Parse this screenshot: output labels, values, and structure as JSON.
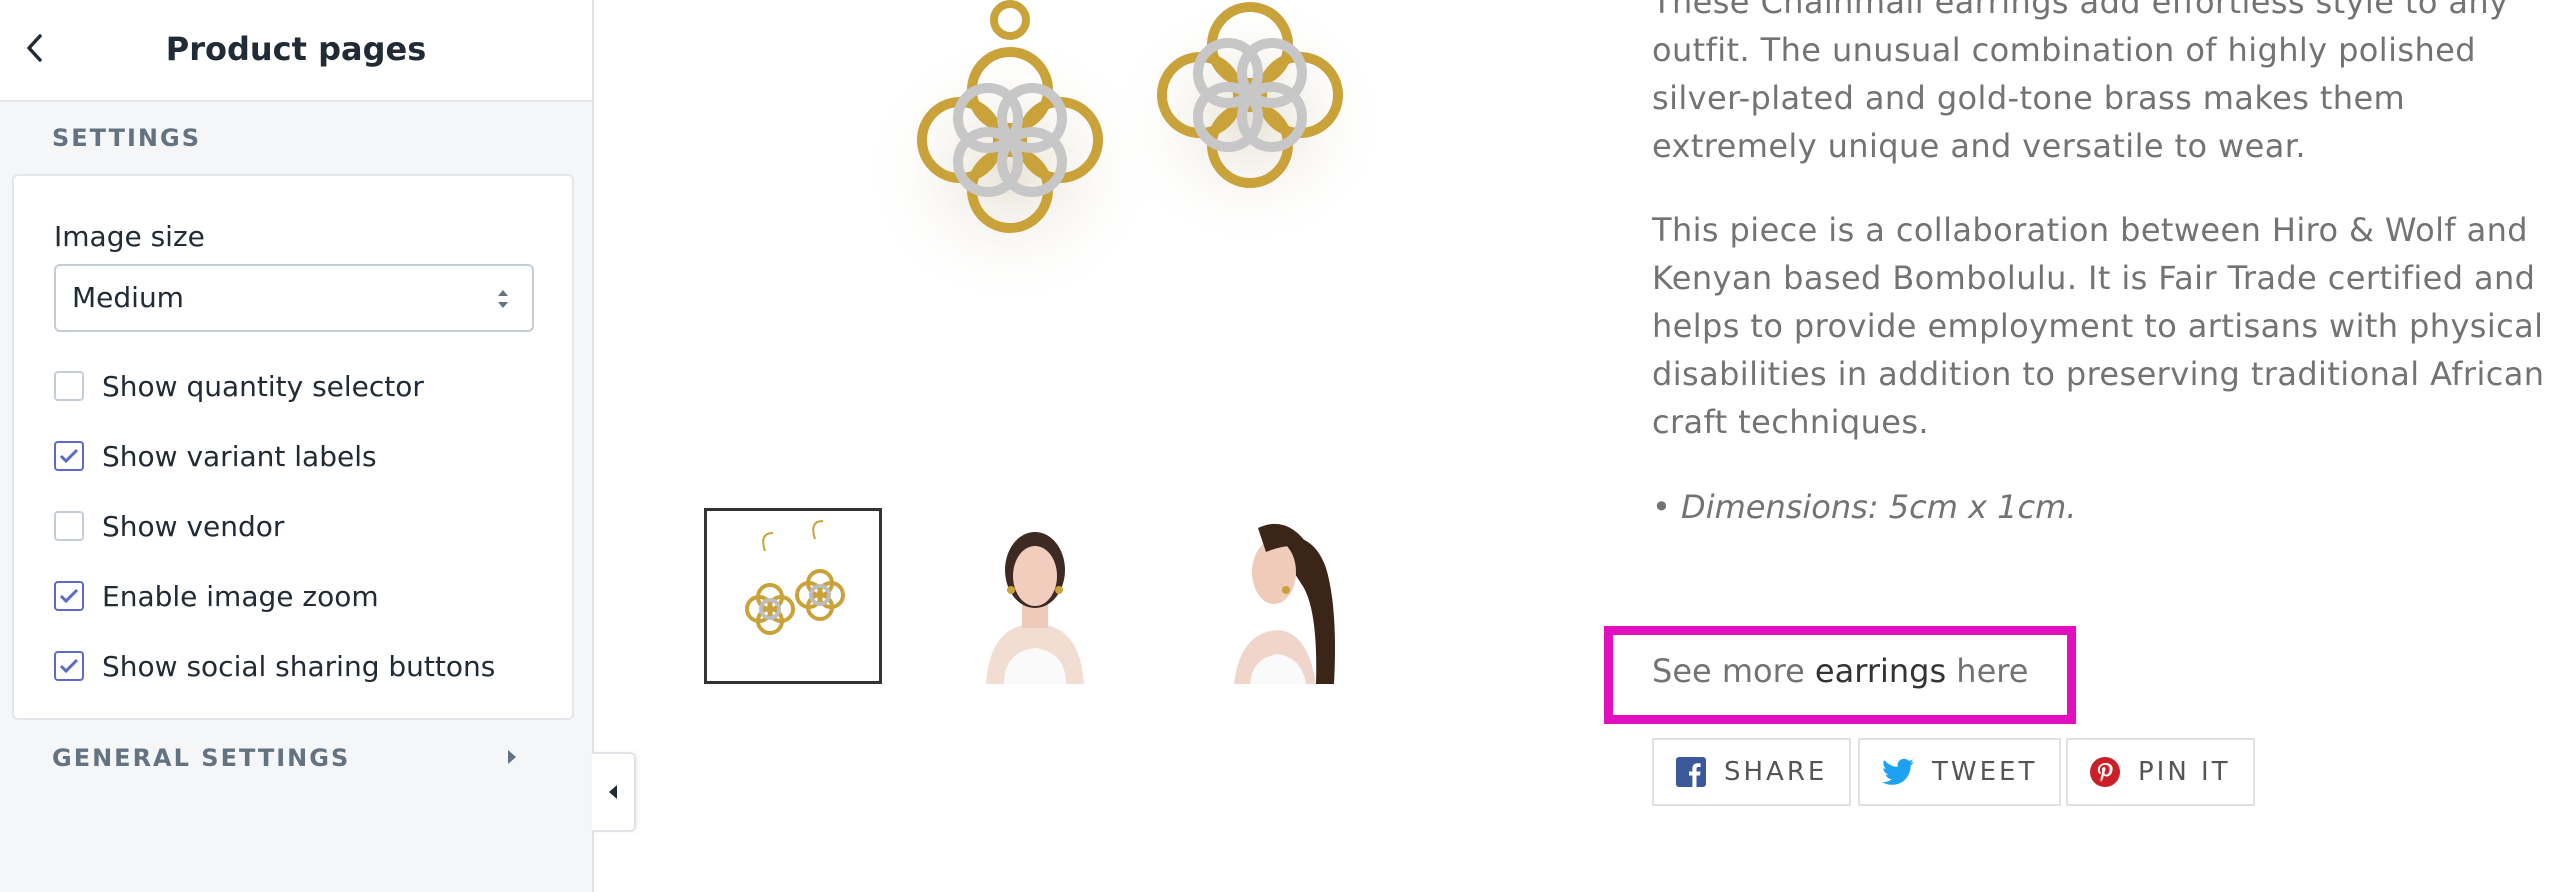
{
  "sidebar": {
    "title": "Product pages",
    "settings_heading": "SETTINGS",
    "image_size": {
      "label": "Image size",
      "value": "Medium"
    },
    "checkboxes": [
      {
        "label": "Show quantity selector",
        "checked": false
      },
      {
        "label": "Show variant labels",
        "checked": true
      },
      {
        "label": "Show vendor",
        "checked": false
      },
      {
        "label": "Enable image zoom",
        "checked": true
      },
      {
        "label": "Show social sharing buttons",
        "checked": true
      }
    ],
    "general_heading": "GENERAL SETTINGS"
  },
  "preview": {
    "description": [
      "These Chainmail earrings add effortless style to any",
      "outfit. The unusual combination of highly polished",
      "silver-plated and gold-tone brass makes them",
      "extremely unique and versatile to wear."
    ],
    "description2": [
      "This piece is a collaboration between Hiro & Wolf and",
      "Kenyan based Bombolulu. It is Fair Trade certified and",
      "helps to provide employment to artisans with physical",
      "disabilities in addition to preserving traditional African",
      "craft techniques."
    ],
    "dimensions": "• Dimensions: 5cm x 1cm.",
    "see_more": {
      "prefix": "See more",
      "link": "earrings",
      "suffix": "here"
    },
    "share": {
      "facebook": "SHARE",
      "twitter": "TWEET",
      "pinterest": "PIN IT"
    }
  },
  "colors": {
    "accent_checkbox": "#5c6ac4",
    "highlight": "#e10fc0",
    "facebook": "#3b5998",
    "twitter": "#1da1f2",
    "pinterest": "#cb2027"
  },
  "icons": [
    "chevron-left-icon",
    "select-arrows-icon",
    "checkmark-icon",
    "triangle-right-icon",
    "triangle-left-icon",
    "facebook-icon",
    "twitter-icon",
    "pinterest-icon"
  ]
}
